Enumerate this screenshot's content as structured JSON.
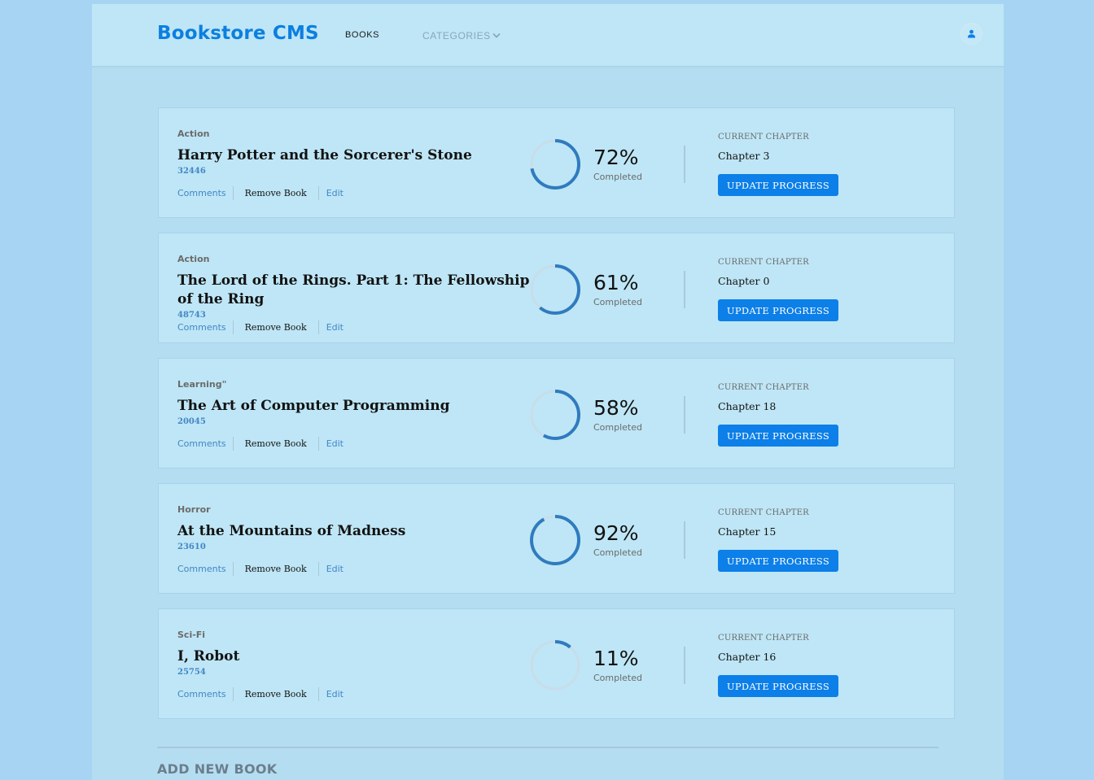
{
  "header": {
    "brand": "Bookstore CMS",
    "nav_books": "BOOKS",
    "nav_categories": "CATEGORIES",
    "icons": {
      "categories": "chevron-down-icon",
      "user": "user-icon"
    }
  },
  "colors": {
    "accent": "#0c7fe8",
    "progress_ring": "#307bbe",
    "ring_track": "#c8dde9"
  },
  "books": [
    {
      "genre": "Action",
      "title": "Harry Potter and the Sorcerer's Stone",
      "author": "32446",
      "actions": {
        "comments": "Comments",
        "remove": "Remove Book",
        "edit": "Edit"
      },
      "percent_text": "72%",
      "percent": 72,
      "completed_label": "Completed",
      "chapter_label": "CURRENT CHAPTER",
      "chapter": "Chapter 3",
      "update_label": "UPDATE PROGRESS"
    },
    {
      "genre": "Action",
      "title": "The Lord of the Rings. Part 1: The Fellowship of the Ring",
      "author": "48743",
      "actions": {
        "comments": "Comments",
        "remove": "Remove Book",
        "edit": "Edit"
      },
      "percent_text": "61%",
      "percent": 61,
      "completed_label": "Completed",
      "chapter_label": "CURRENT CHAPTER",
      "chapter": "Chapter 0",
      "update_label": "UPDATE PROGRESS"
    },
    {
      "genre": "Learning\"",
      "title": "The Art of Computer Programming",
      "author": "20045",
      "actions": {
        "comments": "Comments",
        "remove": "Remove Book",
        "edit": "Edit"
      },
      "percent_text": "58%",
      "percent": 58,
      "completed_label": "Completed",
      "chapter_label": "CURRENT CHAPTER",
      "chapter": "Chapter 18",
      "update_label": "UPDATE PROGRESS"
    },
    {
      "genre": "Horror",
      "title": "At the Mountains of Madness",
      "author": "23610",
      "actions": {
        "comments": "Comments",
        "remove": "Remove Book",
        "edit": "Edit"
      },
      "percent_text": "92%",
      "percent": 92,
      "completed_label": "Completed",
      "chapter_label": "CURRENT CHAPTER",
      "chapter": "Chapter 15",
      "update_label": "UPDATE PROGRESS"
    },
    {
      "genre": "Sci-Fi",
      "title": "I, Robot",
      "author": "25754",
      "actions": {
        "comments": "Comments",
        "remove": "Remove Book",
        "edit": "Edit"
      },
      "percent_text": "11%",
      "percent": 11,
      "completed_label": "Completed",
      "chapter_label": "CURRENT CHAPTER",
      "chapter": "Chapter 16",
      "update_label": "UPDATE PROGRESS"
    }
  ],
  "add_book": {
    "title": "ADD NEW BOOK"
  }
}
